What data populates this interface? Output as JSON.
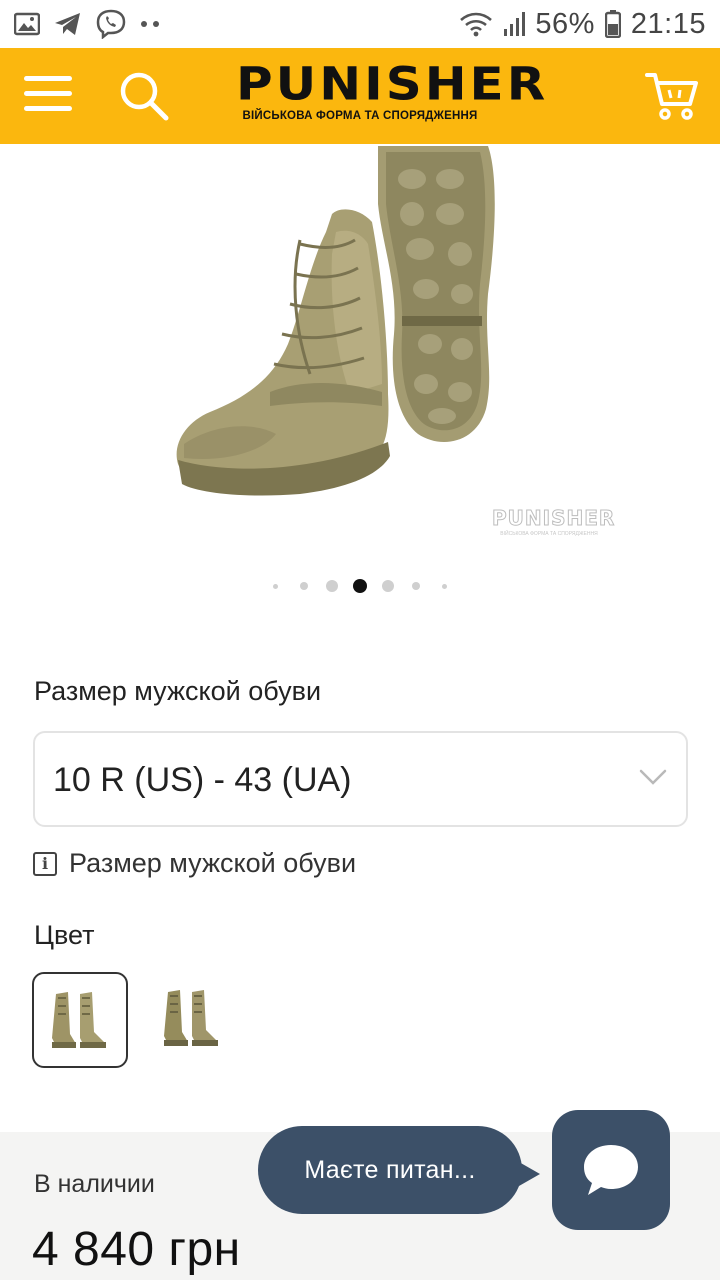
{
  "status_bar": {
    "icons_left": [
      "gallery-icon",
      "telegram-icon",
      "viber-icon",
      "more-dots-icon"
    ],
    "battery": "56%",
    "time": "21:15"
  },
  "header": {
    "logo_name": "PUNISHER",
    "logo_subtitle": "ВІЙСЬКОВА ФОРМА ТА СПОРЯДЖЕННЯ",
    "background_color": "#fbb70e"
  },
  "product": {
    "image_alt_icon": "tactical-boots",
    "watermark": "PUNISHER",
    "carousel": {
      "total": 7,
      "active_index": 3
    }
  },
  "size": {
    "label": "Размер мужской обуви",
    "selected": "10 R (US) - 43 (UA)",
    "info_text": "Размер мужской обуви"
  },
  "color": {
    "label": "Цвет",
    "options": [
      "coyote",
      "olive"
    ],
    "selected_index": 0
  },
  "availability": "В наличии",
  "price": "4 840 грн",
  "chat": {
    "prompt": "Маєте питан...",
    "color": "#3c5068"
  }
}
